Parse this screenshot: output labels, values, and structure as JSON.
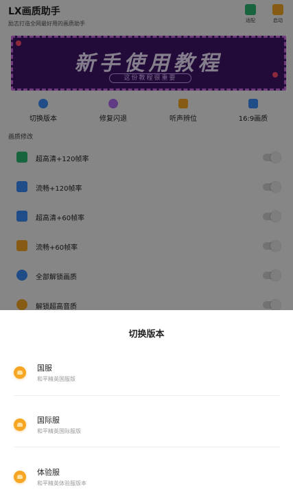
{
  "app": {
    "title": "LX画质助手",
    "subtitle": "励志打造全网最好用的画质助手",
    "header_buttons": [
      {
        "label": "适配",
        "icon": "adapt-icon",
        "color": "#2bb673"
      },
      {
        "label": "启动",
        "icon": "launch-icon",
        "color": "#f5a623"
      }
    ]
  },
  "banner": {
    "title": "新手使用教程",
    "subtitle": "这份教程很重要"
  },
  "quick_actions": [
    {
      "label": "切换版本",
      "icon": "switch-version-icon",
      "color": "#3b8bf7"
    },
    {
      "label": "修复闪退",
      "icon": "repair-icon",
      "color": "#b06cf0"
    },
    {
      "label": "听声辨位",
      "icon": "headphone-icon",
      "color": "#f5a623"
    },
    {
      "label": "16:9画质",
      "icon": "aspect-ratio-icon",
      "color": "#3b8bf7"
    }
  ],
  "quality": {
    "section_title": "画质修改",
    "options": [
      {
        "label": "超高清+120帧率",
        "icon": "uhd-120-icon",
        "color": "#2bb673",
        "enabled": false
      },
      {
        "label": "流畅+120帧率",
        "icon": "smooth-120-icon",
        "color": "#3b8bf7",
        "enabled": false
      },
      {
        "label": "超高清+60帧率",
        "icon": "uhd-60-icon",
        "color": "#3b8bf7",
        "enabled": false
      },
      {
        "label": "流畅+60帧率",
        "icon": "smooth-60-icon",
        "color": "#f5a623",
        "enabled": false
      },
      {
        "label": "全部解锁画质",
        "icon": "unlock-quality-icon",
        "color": "#3b8bf7",
        "enabled": false
      },
      {
        "label": "解锁超高音质",
        "icon": "unlock-audio-icon",
        "color": "#f5a623",
        "enabled": false
      }
    ]
  },
  "sheet": {
    "title": "切换版本",
    "versions": [
      {
        "name": "国服",
        "desc": "和平精英国服版"
      },
      {
        "name": "国际服",
        "desc": "和平精英国际服版"
      },
      {
        "name": "体验服",
        "desc": "和平精英体验服版本"
      }
    ]
  }
}
